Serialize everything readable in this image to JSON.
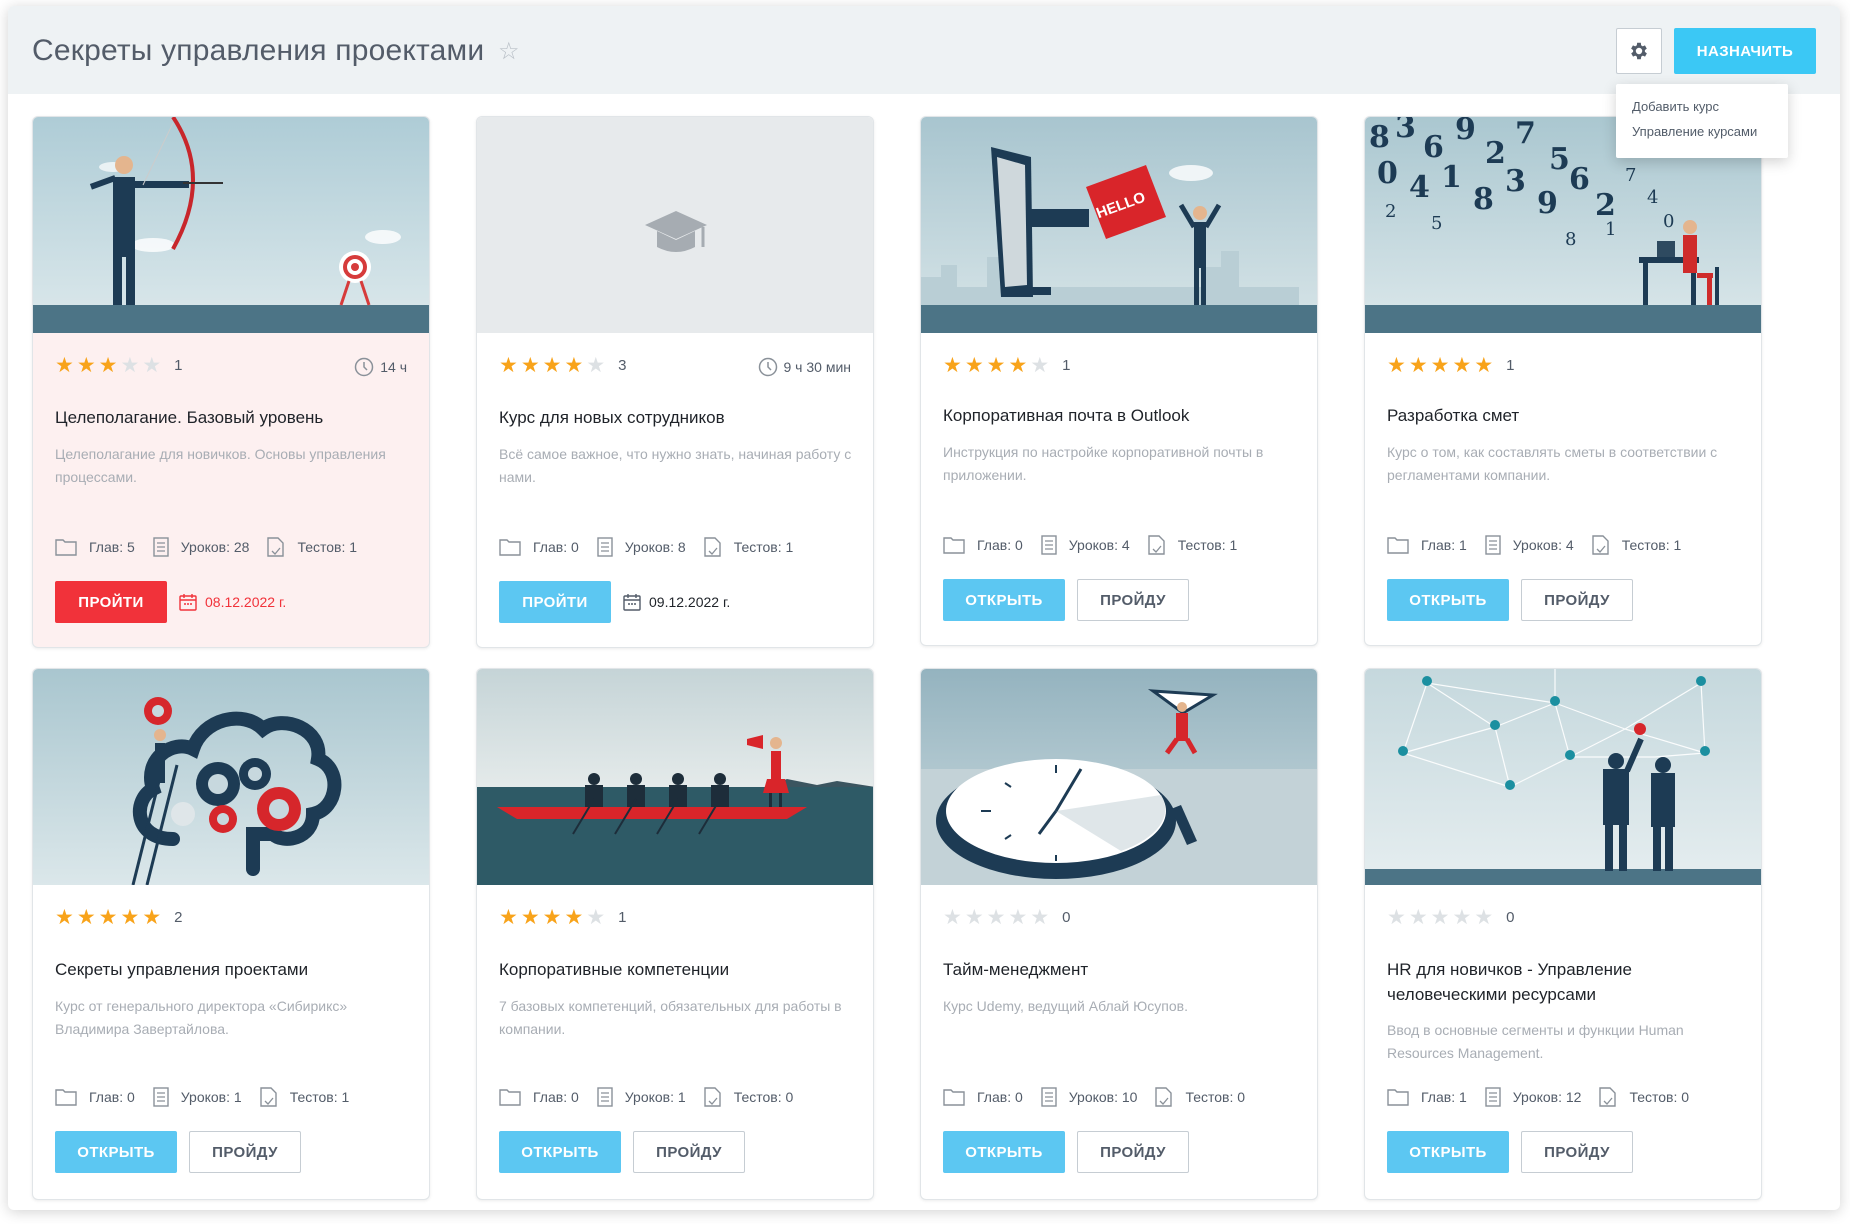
{
  "header": {
    "title": "Секреты управления проектами",
    "assign_label": "НАЗНАЧИТЬ"
  },
  "dropdown": {
    "items": [
      "Добавить курс",
      "Управление курсами"
    ]
  },
  "cards": [
    {
      "rating": 3,
      "reviews": "1",
      "duration": "14 ч",
      "title": "Целеполагание. Базовый уровень",
      "description": "Целеполагание для новичков. Основы управления процессами.",
      "chapters": "Глав: 5",
      "lessons": "Уроков: 28",
      "tests": "Тестов: 1",
      "primary": "ПРОЙТИ",
      "deadline": "08.12.2022 г.",
      "highlight": true
    },
    {
      "rating": 4,
      "reviews": "3",
      "duration": "9 ч 30 мин",
      "title": "Курс для новых сотрудников",
      "description": "Всё самое важное, что нужно знать, начиная работу с нами.",
      "chapters": "Глав: 0",
      "lessons": "Уроков: 8",
      "tests": "Тестов: 1",
      "primary": "ПРОЙТИ",
      "deadline": "09.12.2022 г."
    },
    {
      "rating": 4,
      "reviews": "1",
      "title": "Корпоративная почта в Outlook",
      "description": "Инструкция по настройке корпоративной почты в приложении.",
      "chapters": "Глав: 0",
      "lessons": "Уроков: 4",
      "tests": "Тестов: 1",
      "primary": "ОТКРЫТЬ",
      "secondary": "ПРОЙДУ"
    },
    {
      "rating": 5,
      "reviews": "1",
      "title": "Разработка смет",
      "description": "Курс о том, как составлять сметы в соответствии с регламентами компании.",
      "chapters": "Глав: 1",
      "lessons": "Уроков: 4",
      "tests": "Тестов: 1",
      "primary": "ОТКРЫТЬ",
      "secondary": "ПРОЙДУ"
    },
    {
      "rating": 5,
      "reviews": "2",
      "title": "Секреты управления проектами",
      "description": "Курс от генерального директора «Сибирикс» Владимира Завертайлова.",
      "chapters": "Глав: 0",
      "lessons": "Уроков: 1",
      "tests": "Тестов: 1",
      "primary": "ОТКРЫТЬ",
      "secondary": "ПРОЙДУ"
    },
    {
      "rating": 4,
      "reviews": "1",
      "title": "Корпоративные компетенции",
      "description": "7 базовых компетенций, обязательных для работы в компании.",
      "chapters": "Глав: 0",
      "lessons": "Уроков: 1",
      "tests": "Тестов: 0",
      "primary": "ОТКРЫТЬ",
      "secondary": "ПРОЙДУ"
    },
    {
      "rating": 0,
      "reviews": "0",
      "title": "Тайм-менеджмент",
      "description": "Курс Udemy, ведущий Аблай Юсупов.",
      "chapters": "Глав: 0",
      "lessons": "Уроков: 10",
      "tests": "Тестов: 0",
      "primary": "ОТКРЫТЬ",
      "secondary": "ПРОЙДУ"
    },
    {
      "rating": 0,
      "reviews": "0",
      "title": "HR для новичков - Управление человеческими ресурсами",
      "description": "Ввод в основные сегменты и функции Human Resources Management.",
      "chapters": "Глав: 1",
      "lessons": "Уроков: 12",
      "tests": "Тестов: 0",
      "primary": "ОТКРЫТЬ",
      "secondary": "ПРОЙДУ"
    }
  ],
  "colors": {
    "accent": "#3bc8f5",
    "danger": "#f1323a",
    "star": "#f8a31a",
    "highlight_bg": "#fdf0f0"
  }
}
